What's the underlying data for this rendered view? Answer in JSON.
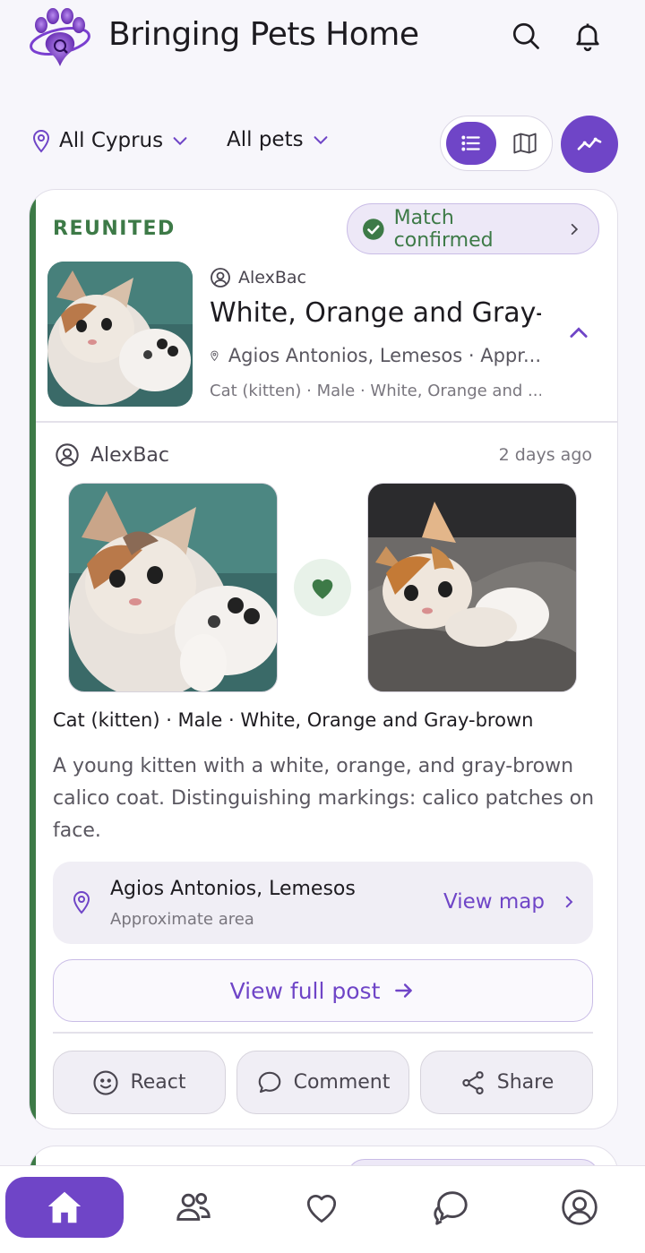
{
  "app": {
    "title": "Bringing Pets Home"
  },
  "filters": {
    "location": "All Cyprus",
    "pets": "All pets"
  },
  "post": {
    "status": "REUNITED",
    "match_chip": "Match confirmed",
    "summary": {
      "user": "AlexBac",
      "title": "White, Orange and Gray-...",
      "location": "Agios Antonios, Lemesos · Appr...",
      "meta": "Cat (kitten) · Male · White, Orange and ..."
    },
    "detail": {
      "user": "AlexBac",
      "time": "2 days ago",
      "attributes": "Cat (kitten) · Male · White, Orange and Gray-brown",
      "description": "A young kitten with a white, orange, and gray-brown calico coat. Distinguishing markings: calico patches on face."
    },
    "location_box": {
      "name": "Agios Antonios, Lemesos",
      "sub": "Approximate area",
      "action": "View map"
    },
    "full_post_label": "View full post",
    "actions": {
      "react": "React",
      "comment": "Comment",
      "share": "Share"
    }
  },
  "colors": {
    "accent": "#6f45c7",
    "reunited_green": "#3d7a47",
    "chip_bg": "#ede8f7"
  },
  "icons": {
    "header": [
      "search-icon",
      "bell-icon"
    ],
    "nav": [
      "home-icon",
      "people-icon",
      "heart-icon",
      "chat-icon",
      "profile-icon"
    ]
  }
}
